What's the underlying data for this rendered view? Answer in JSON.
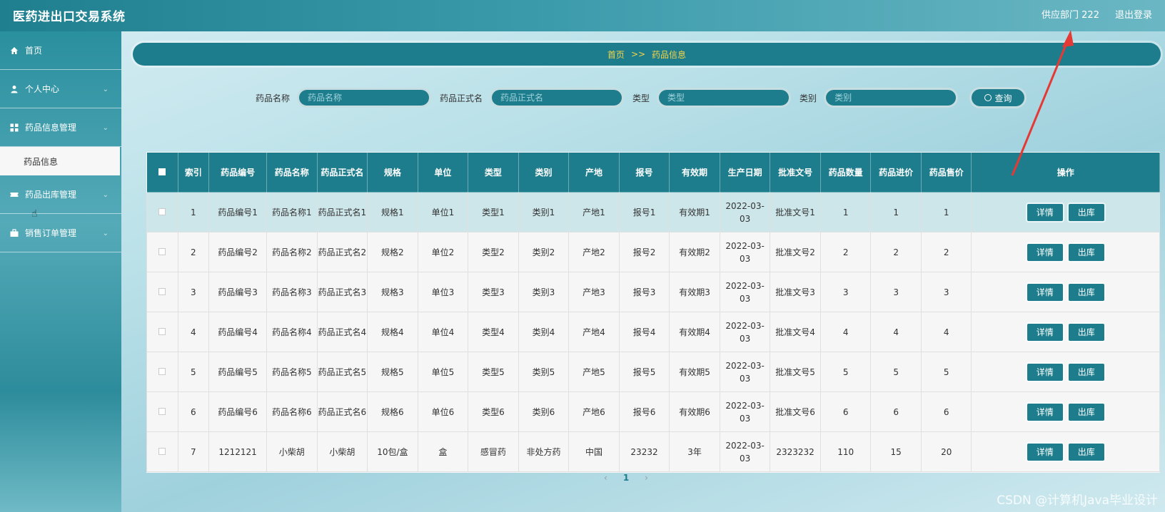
{
  "header": {
    "app_title": "医药进出口交易系统",
    "user_label": "供应部门 222",
    "logout_label": "退出登录"
  },
  "sidebar": {
    "items": [
      {
        "label": "首页",
        "icon": "home-icon"
      },
      {
        "label": "个人中心",
        "icon": "user-icon"
      },
      {
        "label": "药品信息管理",
        "icon": "grid-icon"
      },
      {
        "label": "药品出库管理",
        "icon": "ticket-icon"
      },
      {
        "label": "销售订单管理",
        "icon": "briefcase-icon"
      }
    ],
    "active_subitem": "药品信息"
  },
  "breadcrumb": {
    "home": "首页",
    "separator": ">>",
    "current": "药品信息"
  },
  "search": {
    "fields": [
      {
        "label": "药品名称",
        "placeholder": "药品名称"
      },
      {
        "label": "药品正式名",
        "placeholder": "药品正式名"
      },
      {
        "label": "类型",
        "placeholder": "类型"
      },
      {
        "label": "类别",
        "placeholder": "类别"
      }
    ],
    "button_label": "查询"
  },
  "table": {
    "headers": [
      "索引",
      "药品编号",
      "药品名称",
      "药品正式名",
      "规格",
      "单位",
      "类型",
      "类别",
      "产地",
      "报号",
      "有效期",
      "生产日期",
      "批准文号",
      "药品数量",
      "药品进价",
      "药品售价",
      "操作"
    ],
    "rows": [
      [
        "1",
        "药品编号1",
        "药品名称1",
        "药品正式名1",
        "规格1",
        "单位1",
        "类型1",
        "类别1",
        "产地1",
        "报号1",
        "有效期1",
        "2022-03-03",
        "批准文号1",
        "1",
        "1",
        "1"
      ],
      [
        "2",
        "药品编号2",
        "药品名称2",
        "药品正式名2",
        "规格2",
        "单位2",
        "类型2",
        "类别2",
        "产地2",
        "报号2",
        "有效期2",
        "2022-03-03",
        "批准文号2",
        "2",
        "2",
        "2"
      ],
      [
        "3",
        "药品编号3",
        "药品名称3",
        "药品正式名3",
        "规格3",
        "单位3",
        "类型3",
        "类别3",
        "产地3",
        "报号3",
        "有效期3",
        "2022-03-03",
        "批准文号3",
        "3",
        "3",
        "3"
      ],
      [
        "4",
        "药品编号4",
        "药品名称4",
        "药品正式名4",
        "规格4",
        "单位4",
        "类型4",
        "类别4",
        "产地4",
        "报号4",
        "有效期4",
        "2022-03-03",
        "批准文号4",
        "4",
        "4",
        "4"
      ],
      [
        "5",
        "药品编号5",
        "药品名称5",
        "药品正式名5",
        "规格5",
        "单位5",
        "类型5",
        "类别5",
        "产地5",
        "报号5",
        "有效期5",
        "2022-03-03",
        "批准文号5",
        "5",
        "5",
        "5"
      ],
      [
        "6",
        "药品编号6",
        "药品名称6",
        "药品正式名6",
        "规格6",
        "单位6",
        "类型6",
        "类别6",
        "产地6",
        "报号6",
        "有效期6",
        "2022-03-03",
        "批准文号6",
        "6",
        "6",
        "6"
      ],
      [
        "7",
        "1212121",
        "小柴胡",
        "小柴胡",
        "10包/盒",
        "盒",
        "感冒药",
        "非处方药",
        "中国",
        "23232",
        "3年",
        "2022-03-03",
        "2323232",
        "110",
        "15",
        "20"
      ]
    ],
    "detail_label": "详情",
    "outbound_label": "出库"
  },
  "pagination": {
    "prev": "‹",
    "current_page": "1",
    "next": "›"
  },
  "watermark": "CSDN @计算机Java毕业设计",
  "colors": {
    "primary": "#1e7d8c",
    "breadcrumb_text": "#f5d548",
    "annotation_arrow": "#e53935"
  }
}
